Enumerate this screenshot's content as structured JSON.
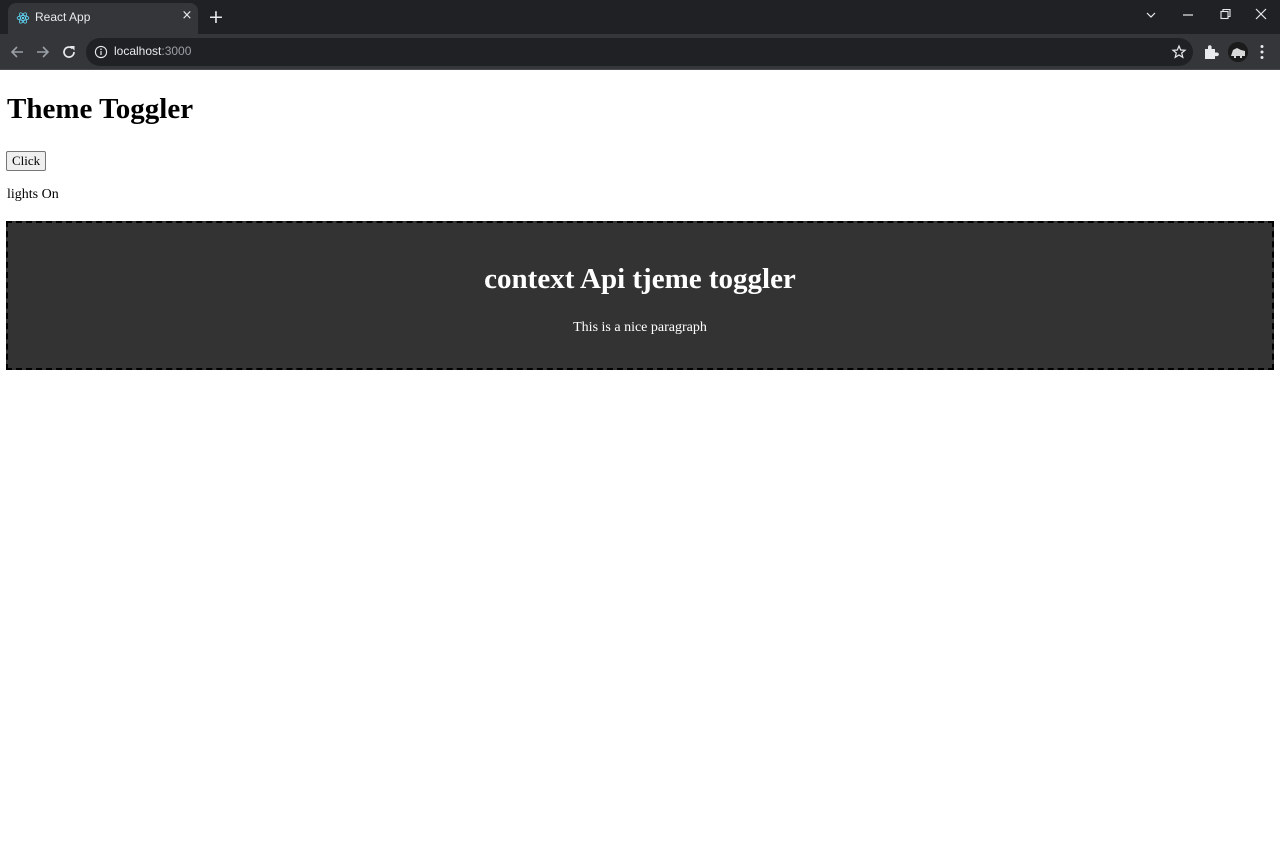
{
  "browser": {
    "tab_title": "React App",
    "tab_close_glyph": "×",
    "new_tab_glyph": "+",
    "url_host": "localhost",
    "url_port": ":3000",
    "icons": [
      "react-favicon-icon",
      "chevron-down-icon",
      "minimize-icon",
      "restore-icon",
      "close-icon",
      "back-icon",
      "forward-icon",
      "reload-icon",
      "info-icon",
      "star-icon",
      "extensions-icon",
      "profile-avatar",
      "kebab-menu-icon"
    ],
    "colors": {
      "tabstrip": "#202124",
      "toolbar": "#35363a",
      "omnibox": "#202124",
      "text": "#e8eaed",
      "react_blue": "#61dafb"
    }
  },
  "page": {
    "title": "Theme Toggler",
    "button_label": "Click",
    "status_text": "lights On",
    "box": {
      "heading": "context Api tjeme toggler",
      "paragraph": "This is a nice paragraph",
      "background": "#333333",
      "text_color": "#ffffff"
    }
  }
}
